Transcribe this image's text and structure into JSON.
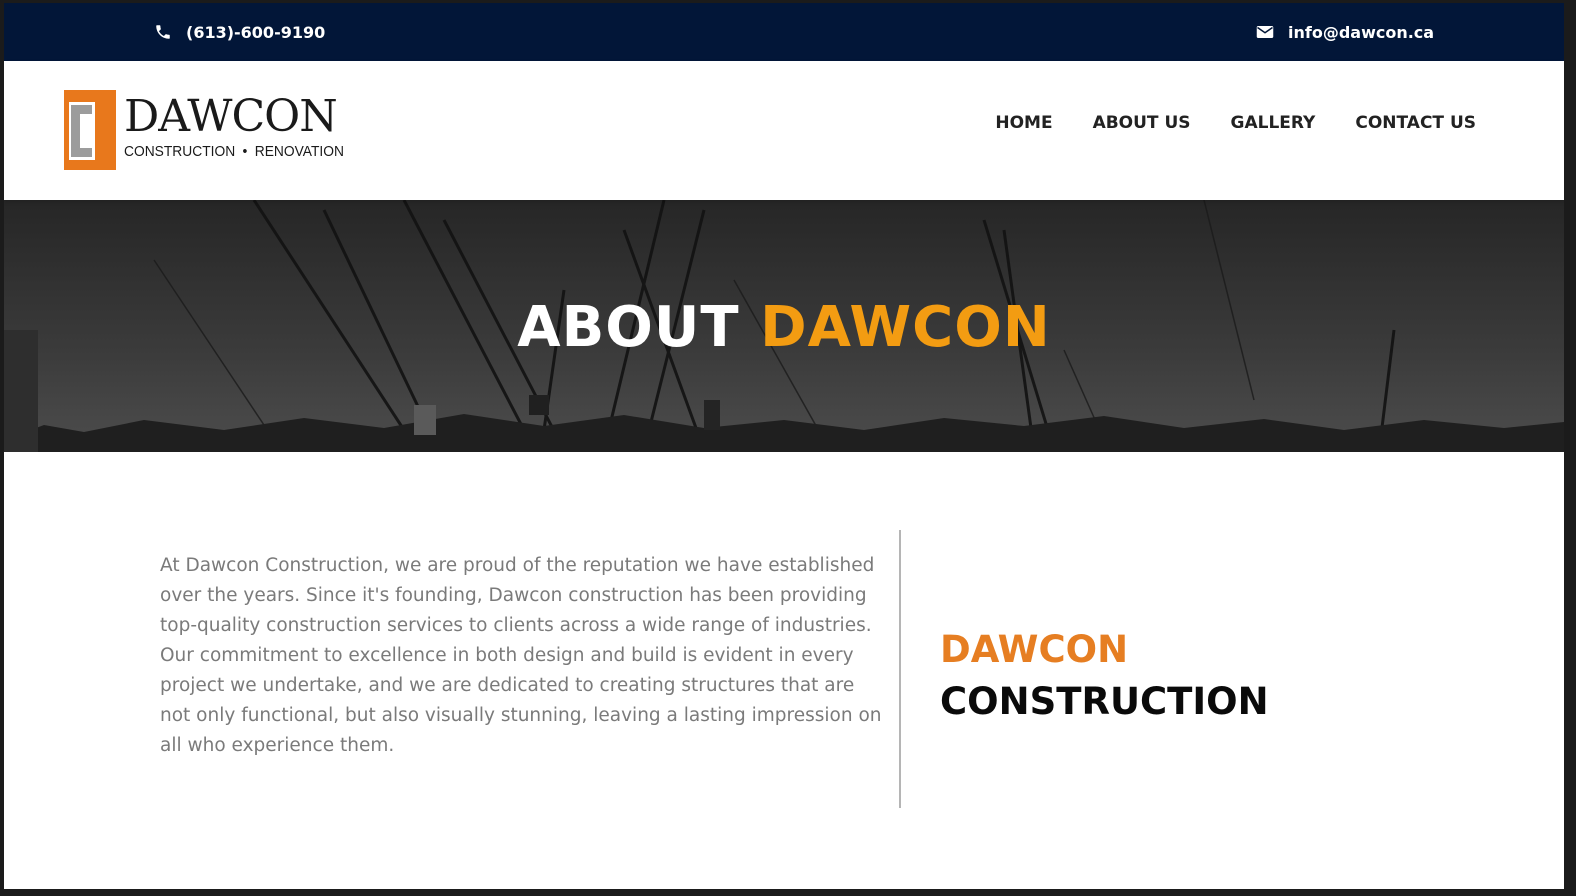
{
  "topbar": {
    "phone": "(613)-600-9190",
    "email": "info@dawcon.ca",
    "phone_icon": "phone-icon",
    "email_icon": "envelope-icon"
  },
  "logo": {
    "name": "DAWCON",
    "tag_left": "CONSTRUCTION",
    "tag_sep": "•",
    "tag_right": "RENOVATION"
  },
  "nav": {
    "items": [
      "HOME",
      "ABOUT US",
      "GALLERY",
      "CONTACT US"
    ]
  },
  "hero": {
    "title_plain": "ABOUT",
    "title_accent": "DAWCON"
  },
  "about": {
    "paragraph": "At Dawcon Construction, we are proud of the reputation we have established over the years. Since it's founding, Dawcon construction has been providing top-quality construction services to clients across a wide range of industries. Our commitment to excellence in both design and build is evident in every project we undertake, and we are dedicated to creating structures that are not only functional, but also visually stunning, leaving a lasting impression on all who experience them.",
    "heading_line1": "DAWCON",
    "heading_line2": "CONSTRUCTION"
  },
  "colors": {
    "topbar_bg": "#021638",
    "accent_orange": "#f39c12",
    "heading_orange": "#e67e22",
    "logo_orange": "#e8781c",
    "logo_grey": "#9c9c9c"
  }
}
